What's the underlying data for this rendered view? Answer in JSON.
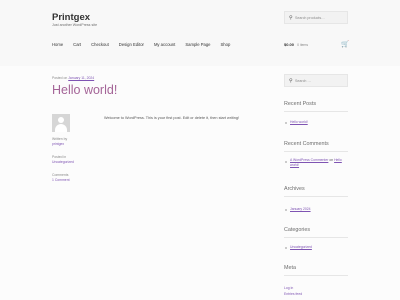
{
  "header": {
    "site_title": "Printgex",
    "site_description": "Just another WordPress site",
    "search_placeholder": "Search products…",
    "nav": [
      "Home",
      "Cart",
      "Checkout",
      "Design Editor",
      "My account",
      "Sample Page",
      "Shop"
    ],
    "cart_price": "$0.00",
    "cart_items": "0 items"
  },
  "post": {
    "posted_prefix": "Posted on",
    "posted_date": "January 11, 2024",
    "title": "Hello world!",
    "written_by_label": "Written by",
    "author": "printgex",
    "posted_in_label": "Posted in",
    "category": "Uncategorized",
    "comments_label": "Comments",
    "comments_link": "1 Comment",
    "content": "Welcome to WordPress. This is your first post. Edit or delete it, then start writing!"
  },
  "sidebar": {
    "search_placeholder": "Search …",
    "recent_posts_title": "Recent Posts",
    "recent_posts": [
      "Hello world!"
    ],
    "recent_comments_title": "Recent Comments",
    "comment_author": "A WordPress Commenter",
    "comment_on": "on",
    "comment_post": "Hello world!",
    "archives_title": "Archives",
    "archives": [
      "January 2024"
    ],
    "categories_title": "Categories",
    "categories": [
      "Uncategorized"
    ],
    "meta_title": "Meta",
    "meta_links": [
      "Log in",
      "Entries feed"
    ]
  },
  "colors": {
    "accent": "#a46497",
    "link": "#7f54b3",
    "text": "#6d6d6d"
  }
}
